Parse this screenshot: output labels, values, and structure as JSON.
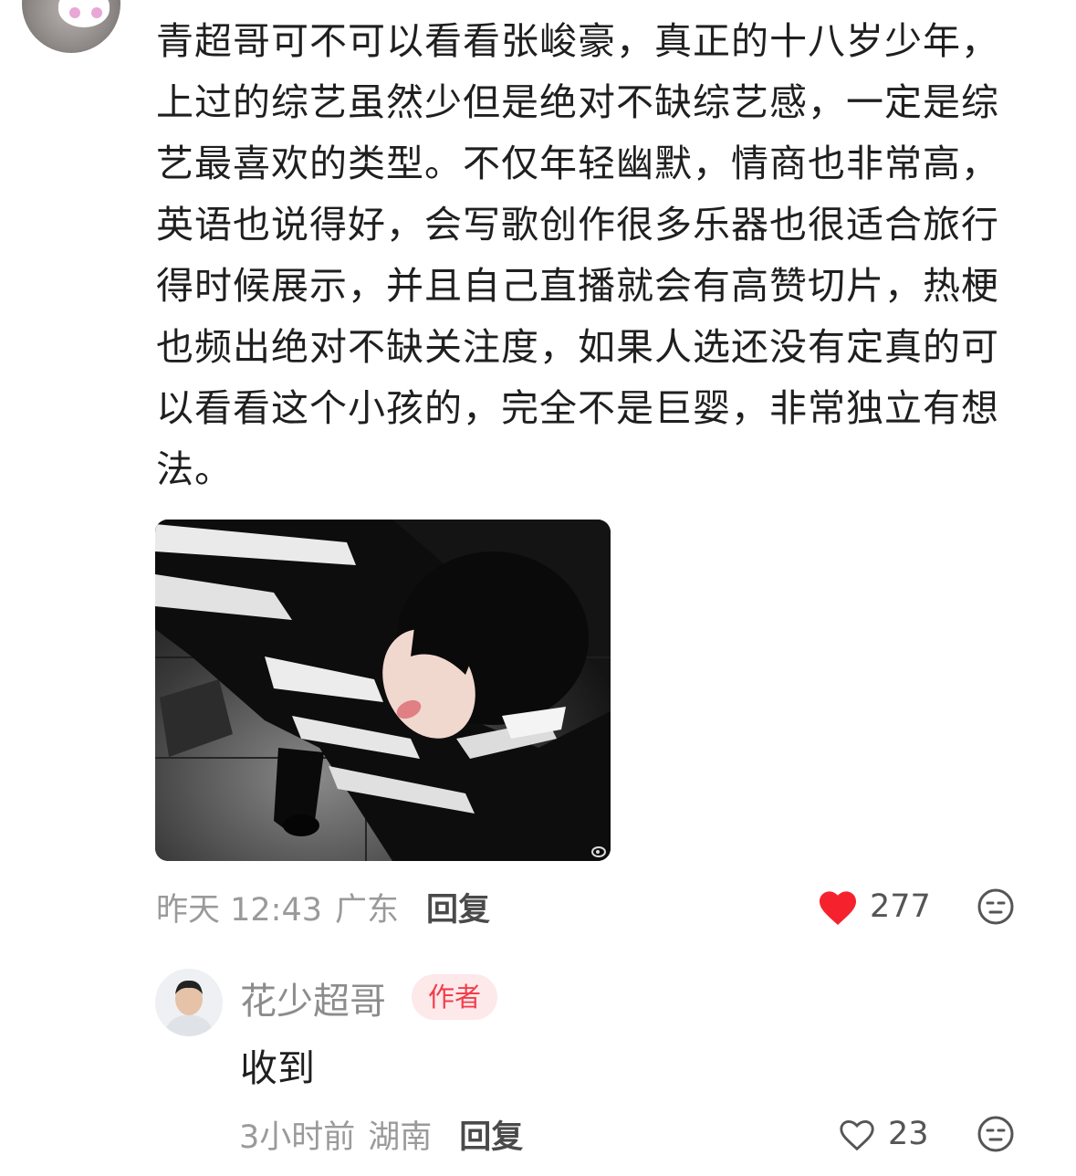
{
  "comment": {
    "text": "青超哥可不可以看看张峻豪，真正的十八岁少年，上过的综艺虽然少但是绝对不缺综艺感，一定是综艺最喜欢的类型。不仅年轻幽默，情商也非常高，英语也说得好，会写歌创作很多乐器也很适合旅行得时候展示，并且自己直播就会有高赞切片，热梗也频出绝对不缺关注度，如果人选还没有定真的可以看看这个小孩的，完全不是巨婴，非常独立有想法。",
    "time": "昨天 12:43",
    "location": "广东",
    "reply_label": "回复",
    "likes": "277",
    "liked": true
  },
  "reply": {
    "user_name": "花少超哥",
    "badge": "作者",
    "text": "收到",
    "time": "3小时前",
    "location": "湖南",
    "reply_label": "回复",
    "likes": "23",
    "liked": false
  },
  "colors": {
    "like_active": "#f5222d",
    "badge_text": "#f23d4a",
    "badge_bg": "#fde8ea",
    "meta_text": "#9a9a9a"
  },
  "icons": [
    "heart-filled-icon",
    "heart-outline-icon",
    "emoji-icon",
    "weibo-watermark-icon"
  ]
}
